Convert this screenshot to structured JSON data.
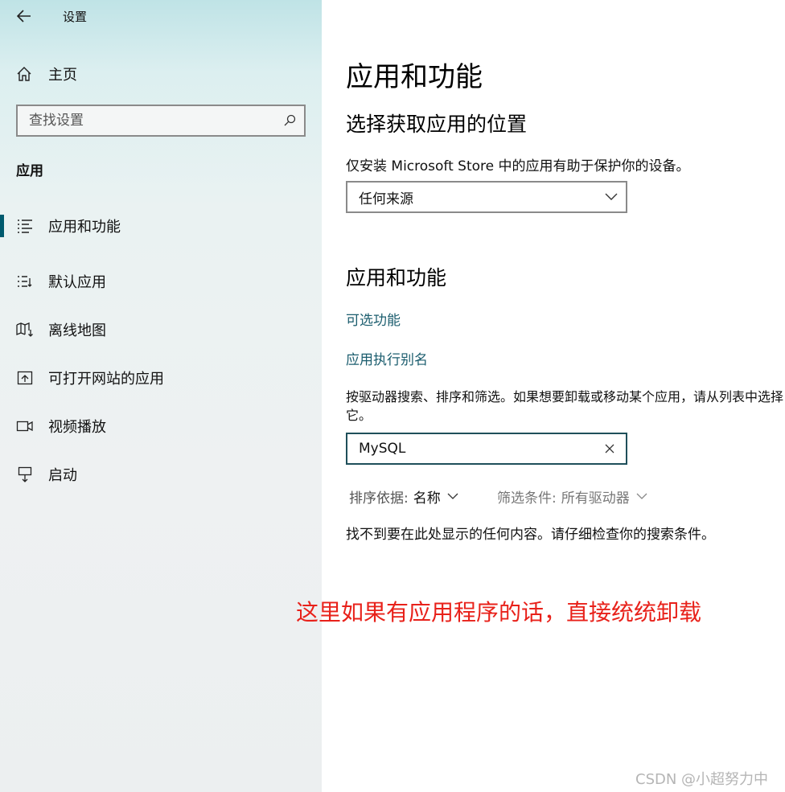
{
  "window": {
    "title": "设置"
  },
  "sidebar": {
    "home_label": "主页",
    "search": {
      "placeholder": "查找设置"
    },
    "section_heading": "应用",
    "items": [
      {
        "label": "应用和功能",
        "icon": "apps-features-icon",
        "selected": true
      },
      {
        "label": "默认应用",
        "icon": "default-apps-icon",
        "selected": false
      },
      {
        "label": "离线地图",
        "icon": "offline-maps-icon",
        "selected": false
      },
      {
        "label": "可打开网站的应用",
        "icon": "apps-for-websites-icon",
        "selected": false
      },
      {
        "label": "视频播放",
        "icon": "video-playback-icon",
        "selected": false
      },
      {
        "label": "启动",
        "icon": "startup-icon",
        "selected": false
      }
    ]
  },
  "main": {
    "title": "应用和功能",
    "choose_location": {
      "heading": "选择获取应用的位置",
      "description": "仅安装 Microsoft Store 中的应用有助于保护你的设备。",
      "dropdown_value": "任何来源"
    },
    "apps_features": {
      "heading": "应用和功能",
      "optional_features_link": "可选功能",
      "app_alias_link": "应用执行别名",
      "description": "按驱动器搜索、排序和筛选。如果想要卸载或移动某个应用，请从列表中选择它。",
      "search_value": "MySQL",
      "sort_label": "排序依据:",
      "sort_value": "名称",
      "filter_label": "筛选条件:",
      "filter_value": "所有驱动器",
      "empty_message": "找不到要在此处显示的任何内容。请仔细检查你的搜索条件。"
    }
  },
  "annotation": "这里如果有应用程序的话，直接统统卸载",
  "watermark": "CSDN @小超努力中",
  "colors": {
    "accent": "#005a6e",
    "link": "#1b5d6e",
    "annotation": "#e8211a"
  }
}
